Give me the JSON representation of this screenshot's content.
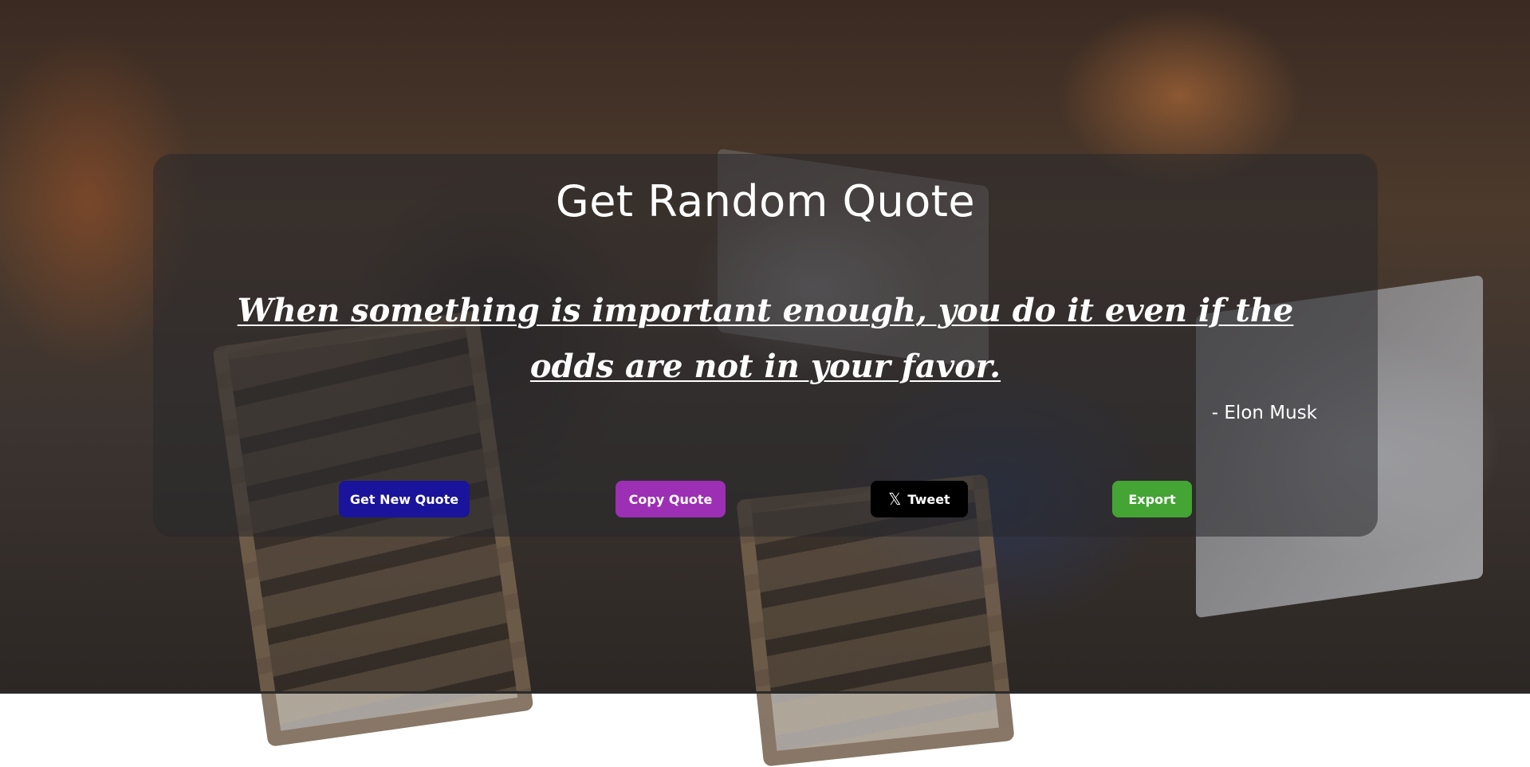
{
  "page": {
    "title": "Get Random Quote"
  },
  "quote": {
    "text": "When something is important enough, you do it even if the odds are not in your favor.",
    "author": "- Elon Musk"
  },
  "buttons": {
    "new_quote": "Get New Quote",
    "copy_quote": "Copy Quote",
    "tweet": "Tweet",
    "export": "Export"
  },
  "icons": {
    "tweet_icon": "x-logo-icon"
  },
  "colors": {
    "new_quote_button": "#19149b",
    "copy_quote_button": "#9c2fb4",
    "tweet_button": "#000000",
    "export_button": "#44a434",
    "card_background": "rgba(40,40,44,0.55)"
  }
}
